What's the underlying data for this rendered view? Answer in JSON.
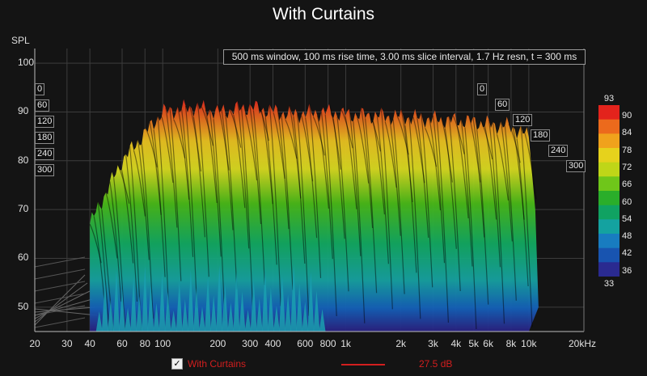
{
  "chart_data": {
    "type": "waterfall",
    "title": "With Curtains",
    "ylabel": "SPL",
    "info_text": "500 ms window, 100 ms rise time, 3.00 ms slice interval, 1.7 Hz resn, t = 300 ms",
    "y_ticks": [
      "100",
      "90",
      "80",
      "70",
      "60",
      "50"
    ],
    "ylim": [
      45,
      103
    ],
    "x_ticks": [
      "20",
      "30",
      "40",
      "60",
      "80",
      "100",
      "200",
      "300",
      "400",
      "600",
      "800",
      "1k",
      "2k",
      "3k",
      "4k",
      "5k",
      "6k",
      "8k",
      "10k",
      "20kHz"
    ],
    "x_tick_values": [
      20,
      30,
      40,
      60,
      80,
      100,
      200,
      300,
      400,
      600,
      800,
      1000,
      2000,
      3000,
      4000,
      5000,
      6000,
      8000,
      10000,
      20000
    ],
    "xscale": "log",
    "xlim": [
      20,
      20000
    ],
    "time_ticks_left": [
      "0",
      "60",
      "120",
      "180",
      "240",
      "300"
    ],
    "time_ticks_right": [
      "0",
      "60",
      "120",
      "180",
      "240",
      "300"
    ],
    "time_unit": "ms",
    "colorbar": {
      "max": "93",
      "min": "33",
      "labels": [
        "90",
        "84",
        "78",
        "72",
        "66",
        "60",
        "54",
        "48",
        "42",
        "36"
      ]
    },
    "front_slice_envelope": {
      "x": [
        40,
        60,
        100,
        150,
        200,
        300,
        500,
        800,
        1000,
        2000,
        3000,
        5000,
        6000,
        8000,
        10000
      ],
      "y": [
        67,
        80,
        90,
        91,
        90,
        91,
        89.5,
        90,
        89.5,
        89,
        88.5,
        88,
        87.5,
        87,
        85
      ]
    },
    "grid": true,
    "legend": {
      "checked": true,
      "series_name": "With Curtains",
      "value": "27.5 dB",
      "color": "#d21e1e"
    }
  }
}
